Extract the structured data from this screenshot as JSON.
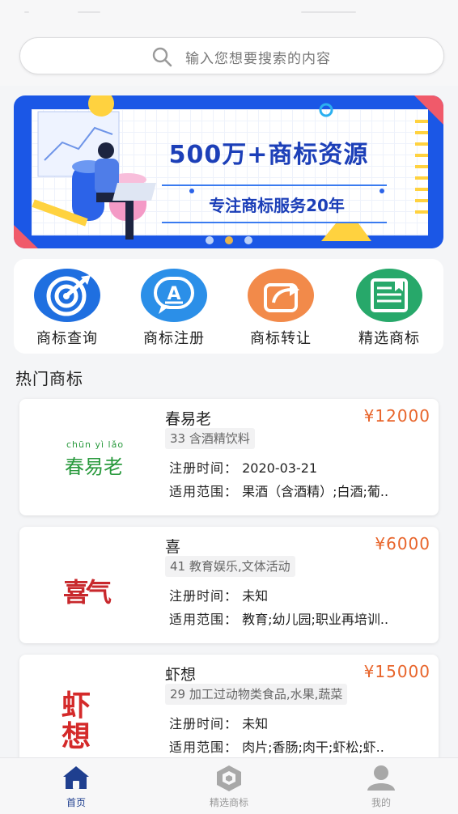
{
  "search": {
    "placeholder": "输入您想要搜索的内容"
  },
  "banner": {
    "title": "500万+商标资源",
    "subtitle": "专注商标服务20年",
    "colors": {
      "background": "#1b57e6",
      "text": "#1c3fb8"
    }
  },
  "categories": [
    {
      "label": "商标查询",
      "icon": "target-icon",
      "color": "#1f6fe0"
    },
    {
      "label": "商标注册",
      "icon": "chat-a-icon",
      "color": "#2b8fe8"
    },
    {
      "label": "商标转让",
      "icon": "share-icon",
      "color": "#f28a4a"
    },
    {
      "label": "精选商标",
      "icon": "book-icon",
      "color": "#27a86a"
    }
  ],
  "section": {
    "title": "热门商标"
  },
  "trademarks": [
    {
      "name": "春易老",
      "price": "¥12000",
      "class": "33 含酒精饮料",
      "reg_label": "注册时间：",
      "reg_value": "2020-03-21",
      "scope_label": "适用范围：",
      "scope_value": "果酒（含酒精）;白酒;葡..",
      "logo_pinyin": "chūn yì lǎo",
      "logo_text": "春易老"
    },
    {
      "name": "喜",
      "price": "¥6000",
      "class": "41 教育娱乐,文体活动",
      "reg_label": "注册时间：",
      "reg_value": "未知",
      "scope_label": "适用范围：",
      "scope_value": "教育;幼儿园;职业再培训..",
      "logo_text": "喜气"
    },
    {
      "name": "虾想",
      "price": "¥15000",
      "class": "29 加工过动物类食品,水果,蔬菜",
      "reg_label": "注册时间：",
      "reg_value": "未知",
      "scope_label": "适用范围：",
      "scope_value": "肉片;香肠;肉干;虾松;虾..",
      "logo_text": "虾想"
    }
  ],
  "nav": [
    {
      "label": "首页",
      "icon": "home-icon",
      "active": true,
      "color": "#1f3f8f"
    },
    {
      "label": "精选商标",
      "icon": "hexagon-icon",
      "active": false,
      "color": "#999999"
    },
    {
      "label": "我的",
      "icon": "user-icon",
      "active": false,
      "color": "#999999"
    }
  ]
}
